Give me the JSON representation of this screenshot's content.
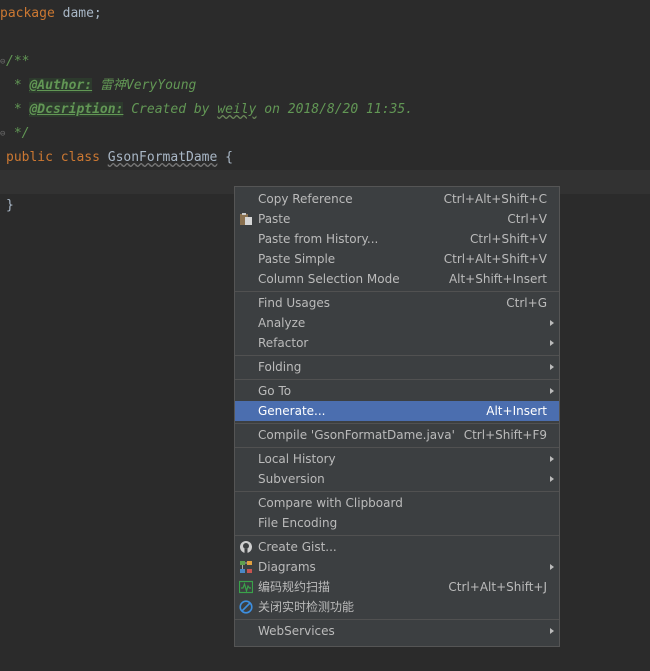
{
  "editor": {
    "lines": {
      "l1_kw": "package",
      "l1_rest": " dame;",
      "l3": "/**",
      "l4_star": " * ",
      "l4_tag": "@Author:",
      "l4_rest": " 雷神VeryYoung",
      "l5_star": " * ",
      "l5_tag": "@Dcsription:",
      "l5_rest1": " Created by ",
      "l5_name": "weily",
      "l5_rest2": " on 2018/8/20 11:35.",
      "l6": " */",
      "l7_kw": "public class ",
      "l7_name": "GsonFormatDame",
      "l7_rest": " {",
      "l9": "}"
    }
  },
  "context_menu": {
    "items": [
      {
        "label": "Copy Reference",
        "shortcut": "Ctrl+Alt+Shift+C"
      },
      {
        "label": "Paste",
        "shortcut": "Ctrl+V",
        "icon": "paste-icon"
      },
      {
        "label": "Paste from History...",
        "shortcut": "Ctrl+Shift+V"
      },
      {
        "label": "Paste Simple",
        "shortcut": "Ctrl+Alt+Shift+V"
      },
      {
        "label": "Column Selection Mode",
        "shortcut": "Alt+Shift+Insert"
      },
      {
        "label": "Find Usages",
        "shortcut": "Ctrl+G"
      },
      {
        "label": "Analyze",
        "submenu": true
      },
      {
        "label": "Refactor",
        "submenu": true
      },
      {
        "label": "Folding",
        "submenu": true
      },
      {
        "label": "Go To",
        "submenu": true
      },
      {
        "label": "Generate...",
        "shortcut": "Alt+Insert",
        "selected": true
      },
      {
        "label": "Compile 'GsonFormatDame.java'",
        "shortcut": "Ctrl+Shift+F9"
      },
      {
        "label": "Local History",
        "submenu": true
      },
      {
        "label": "Subversion",
        "submenu": true
      },
      {
        "label": "Compare with Clipboard"
      },
      {
        "label": "File Encoding"
      },
      {
        "label": "Create Gist...",
        "icon": "github-icon"
      },
      {
        "label": "Diagrams",
        "submenu": true,
        "icon": "diagram-icon"
      },
      {
        "label": "编码规约扫描",
        "shortcut": "Ctrl+Alt+Shift+J",
        "icon": "scan-icon"
      },
      {
        "label": "关闭实时检测功能",
        "icon": "disable-icon"
      },
      {
        "label": "WebServices",
        "submenu": true
      }
    ]
  },
  "colors": {
    "editor_bg": "#2b2b2b",
    "menu_bg": "#3c3f41",
    "selection": "#4b6eaf",
    "keyword": "#cc7832",
    "doc_comment": "#629755"
  }
}
